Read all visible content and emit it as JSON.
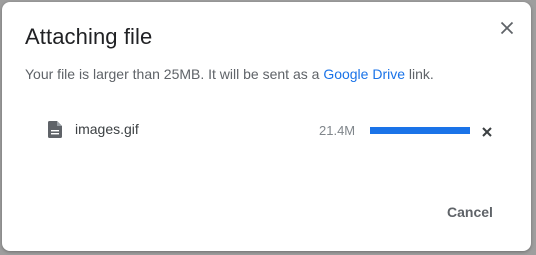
{
  "dialog": {
    "title": "Attaching file",
    "message_prefix": "Your file is larger than 25MB. It will be sent as a ",
    "message_link": "Google Drive",
    "message_suffix": " link.",
    "close_icon": "close-icon",
    "cancel_label": "Cancel"
  },
  "file": {
    "icon": "file-icon",
    "name": "images.gif",
    "size": "21.4M",
    "progress": 1.0,
    "remove_icon": "remove-icon"
  },
  "colors": {
    "link": "#1a73e8",
    "progress": "#1a73e8",
    "title": "#202124",
    "text": "#5f6368"
  }
}
